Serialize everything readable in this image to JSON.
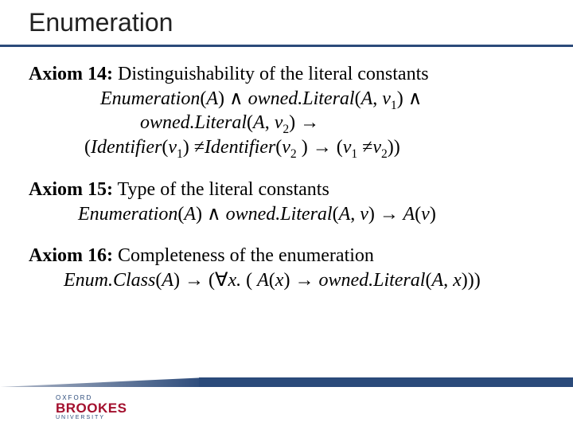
{
  "title": "Enumeration",
  "axiom14": {
    "head": "Axiom 14:",
    "desc": " Distinguishability of the literal constants",
    "line1a": "Enumeration",
    "line1b": "(",
    "line1c": "A",
    "line1d": ") ",
    "line1e": "∧",
    "line1f": " owned.Literal",
    "line1g": "(",
    "line1h": "A",
    "line1i": ", ",
    "line1j": "v",
    "line1k": "1",
    "line1l": ") ",
    "line1m": "∧",
    "line2a": "owned.Literal",
    "line2b": "(",
    "line2c": "A",
    "line2d": ", ",
    "line2e": "v",
    "line2f": "2",
    "line2g": ") ",
    "line2h": "→",
    "line3a": "(",
    "line3b": "Identifier",
    "line3c": "(",
    "line3d": "v",
    "line3e": "1",
    "line3f": ") ",
    "line3g": "≠",
    "line3h": "Identifier",
    "line3i": "(",
    "line3j": "v",
    "line3k": "2",
    "line3l": " ) ",
    "line3m": "→",
    "line3n": " (",
    "line3o": "v",
    "line3p": "1",
    "line3q": " ",
    "line3r": "≠",
    "line3s": "v",
    "line3t": "2",
    "line3u": "))"
  },
  "axiom15": {
    "head": "Axiom 15:",
    "desc": " Type of the literal constants",
    "l1": "Enumeration",
    "l2": "(",
    "l3": "A",
    "l4": ") ",
    "l5": "∧",
    "l6": " owned.Literal",
    "l7": "(",
    "l8": "A",
    "l9": ", ",
    "l10": "v",
    "l11": ") ",
    "l12": "→",
    "l13": " A",
    "l14": "(",
    "l15": "v",
    "l16": ")"
  },
  "axiom16": {
    "head": "Axiom 16:",
    "desc": " Completeness of the enumeration",
    "l1": "Enum.Class",
    "l2": "(",
    "l3": "A",
    "l4": ") ",
    "l5": "→",
    "l6": " (",
    "l7": "∀",
    "l8": "x. ",
    "l9": "( ",
    "l10": "A",
    "l11": "(",
    "l12": "x",
    "l13": ") ",
    "l14": "→",
    "l15": " owned.Literal",
    "l16": "(",
    "l17": "A",
    "l18": ", ",
    "l19": "x",
    "l20": ")))"
  },
  "logo": {
    "ox": "OXFORD",
    "brookes": "BROOKES",
    "uni": "UNIVERSITY"
  }
}
